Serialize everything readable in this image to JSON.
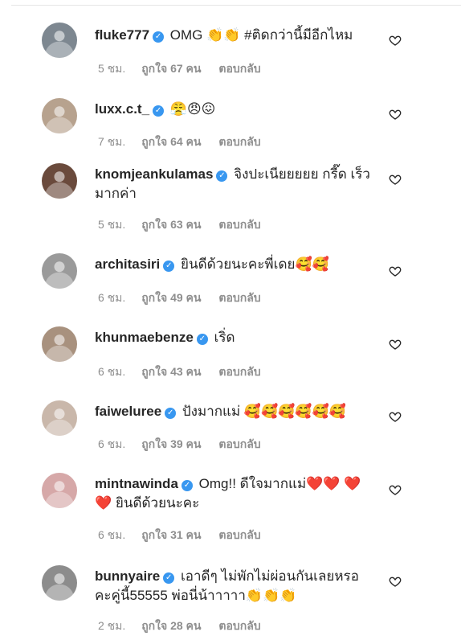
{
  "comments": [
    {
      "username": "fluke777",
      "text": "OMG 👏👏 #ติดกว่านี้มีอีกไหม",
      "time": "5 ชม.",
      "likes": "ถูกใจ 67 คน",
      "reply": "ตอบกลับ",
      "avatar_color": "#7d8790"
    },
    {
      "username": "luxx.c.t_",
      "text": "😤😠😖",
      "time": "7 ชม.",
      "likes": "ถูกใจ 64 คน",
      "reply": "ตอบกลับ",
      "avatar_color": "#b7a28e"
    },
    {
      "username": "knomjeankulamas",
      "text": "จิงปะเนียยยยย กรี๊ด เร็วมากค่า",
      "time": "5 ชม.",
      "likes": "ถูกใจ 63 คน",
      "reply": "ตอบกลับ",
      "avatar_color": "#6a4a3c"
    },
    {
      "username": "architasiri",
      "text": "ยินดีด้วยนะคะพี่เดย🥰🥰",
      "time": "6 ชม.",
      "likes": "ถูกใจ 49 คน",
      "reply": "ตอบกลับ",
      "avatar_color": "#9a9a9a"
    },
    {
      "username": "khunmaebenze",
      "text": "เริ่ด",
      "time": "6 ชม.",
      "likes": "ถูกใจ 43 คน",
      "reply": "ตอบกลับ",
      "avatar_color": "#a8917e"
    },
    {
      "username": "faiweluree",
      "text": "ปังมากแม่ 🥰🥰🥰🥰🥰🥰",
      "time": "6 ชม.",
      "likes": "ถูกใจ 39 คน",
      "reply": "ตอบกลับ",
      "avatar_color": "#c9b7aa"
    },
    {
      "username": "mintnawinda",
      "text": "Omg!! ดีใจมากแม่❤️❤️ ❤️❤️ ยินดีด้วยนะคะ",
      "time": "6 ชม.",
      "likes": "ถูกใจ 31 คน",
      "reply": "ตอบกลับ",
      "avatar_color": "#d6a8a8"
    },
    {
      "username": "bunnyaire",
      "text": "เอาดีๆ ไม่พักไม่ผ่อนกันเลยหรอ คะคู่นี้55555 พ่อนี่น้าาาาา👏👏👏",
      "time": "2 ชม.",
      "likes": "ถูกใจ 28 คน",
      "reply": "ตอบกลับ",
      "avatar_color": "#8c8c8c"
    }
  ],
  "colors": {
    "verified": "#3897f0",
    "meta": "#8e8e8e",
    "text": "#262626"
  }
}
